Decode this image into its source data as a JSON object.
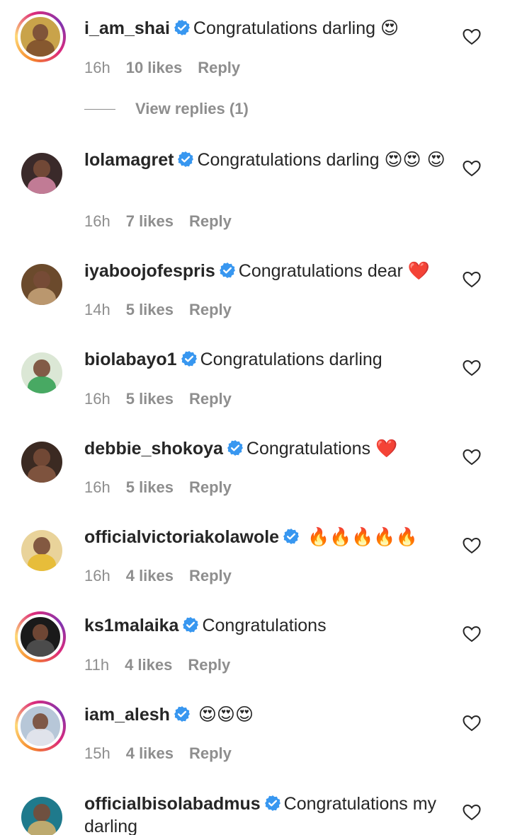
{
  "comments": [
    {
      "username": "i_am_shai",
      "text": "Congratulations darling",
      "emoji": "😍",
      "time": "16h",
      "likes": "10 likes",
      "reply": "Reply",
      "view_replies": "View replies (1)",
      "avatar_colors": [
        "#c9a34a",
        "#7a4b2a"
      ]
    },
    {
      "username": "lolamagret",
      "text": "Congratulations darling",
      "emoji": "😍😍 😍",
      "time": "16h",
      "likes": "7 likes",
      "reply": "Reply",
      "avatar_colors": [
        "#3a2a2a",
        "#d98aa8"
      ]
    },
    {
      "username": "iyaboojofespris",
      "text": "Congratulations dear",
      "emoji": "❤️",
      "time": "14h",
      "likes": "5 likes",
      "reply": "Reply",
      "avatar_colors": [
        "#6b4a2c",
        "#c8a57a"
      ]
    },
    {
      "username": "biolabayo1",
      "text": "Congratulations darling",
      "emoji": "",
      "time": "16h",
      "likes": "5 likes",
      "reply": "Reply",
      "avatar_colors": [
        "#dbe7d5",
        "#2e9d4f"
      ]
    },
    {
      "username": "debbie_shokoya",
      "text": "Congratulations",
      "emoji": "❤️",
      "time": "16h",
      "likes": "5 likes",
      "reply": "Reply",
      "avatar_colors": [
        "#3b2a22",
        "#8b5a43"
      ]
    },
    {
      "username": "officialvictoriakolawole",
      "text": "",
      "emoji": "🔥🔥🔥🔥🔥",
      "time": "16h",
      "likes": "4 likes",
      "reply": "Reply",
      "avatar_colors": [
        "#e9d39a",
        "#e6b829"
      ]
    },
    {
      "username": "ks1malaika",
      "text": "Congratulations",
      "emoji": "",
      "time": "11h",
      "likes": "4 likes",
      "reply": "Reply",
      "avatar_colors": [
        "#1a1a1a",
        "#555555"
      ]
    },
    {
      "username": "iam_alesh",
      "text": "",
      "emoji": "😍😍😍",
      "time": "15h",
      "likes": "4 likes",
      "reply": "Reply",
      "avatar_colors": [
        "#b7c7d8",
        "#e8e8ef"
      ]
    },
    {
      "username": "officialbisolabadmus",
      "text": "Congratulations my darling",
      "emoji": "",
      "time": "",
      "likes": "",
      "reply": "",
      "avatar_colors": [
        "#1f7a8c",
        "#d9b36a"
      ]
    }
  ],
  "colors": {
    "text": "#262626",
    "secondary": "#8e8e8e",
    "verified": "#3897f0"
  },
  "icons": {
    "like": "heart-outline-icon",
    "verified": "verified-badge-icon"
  }
}
